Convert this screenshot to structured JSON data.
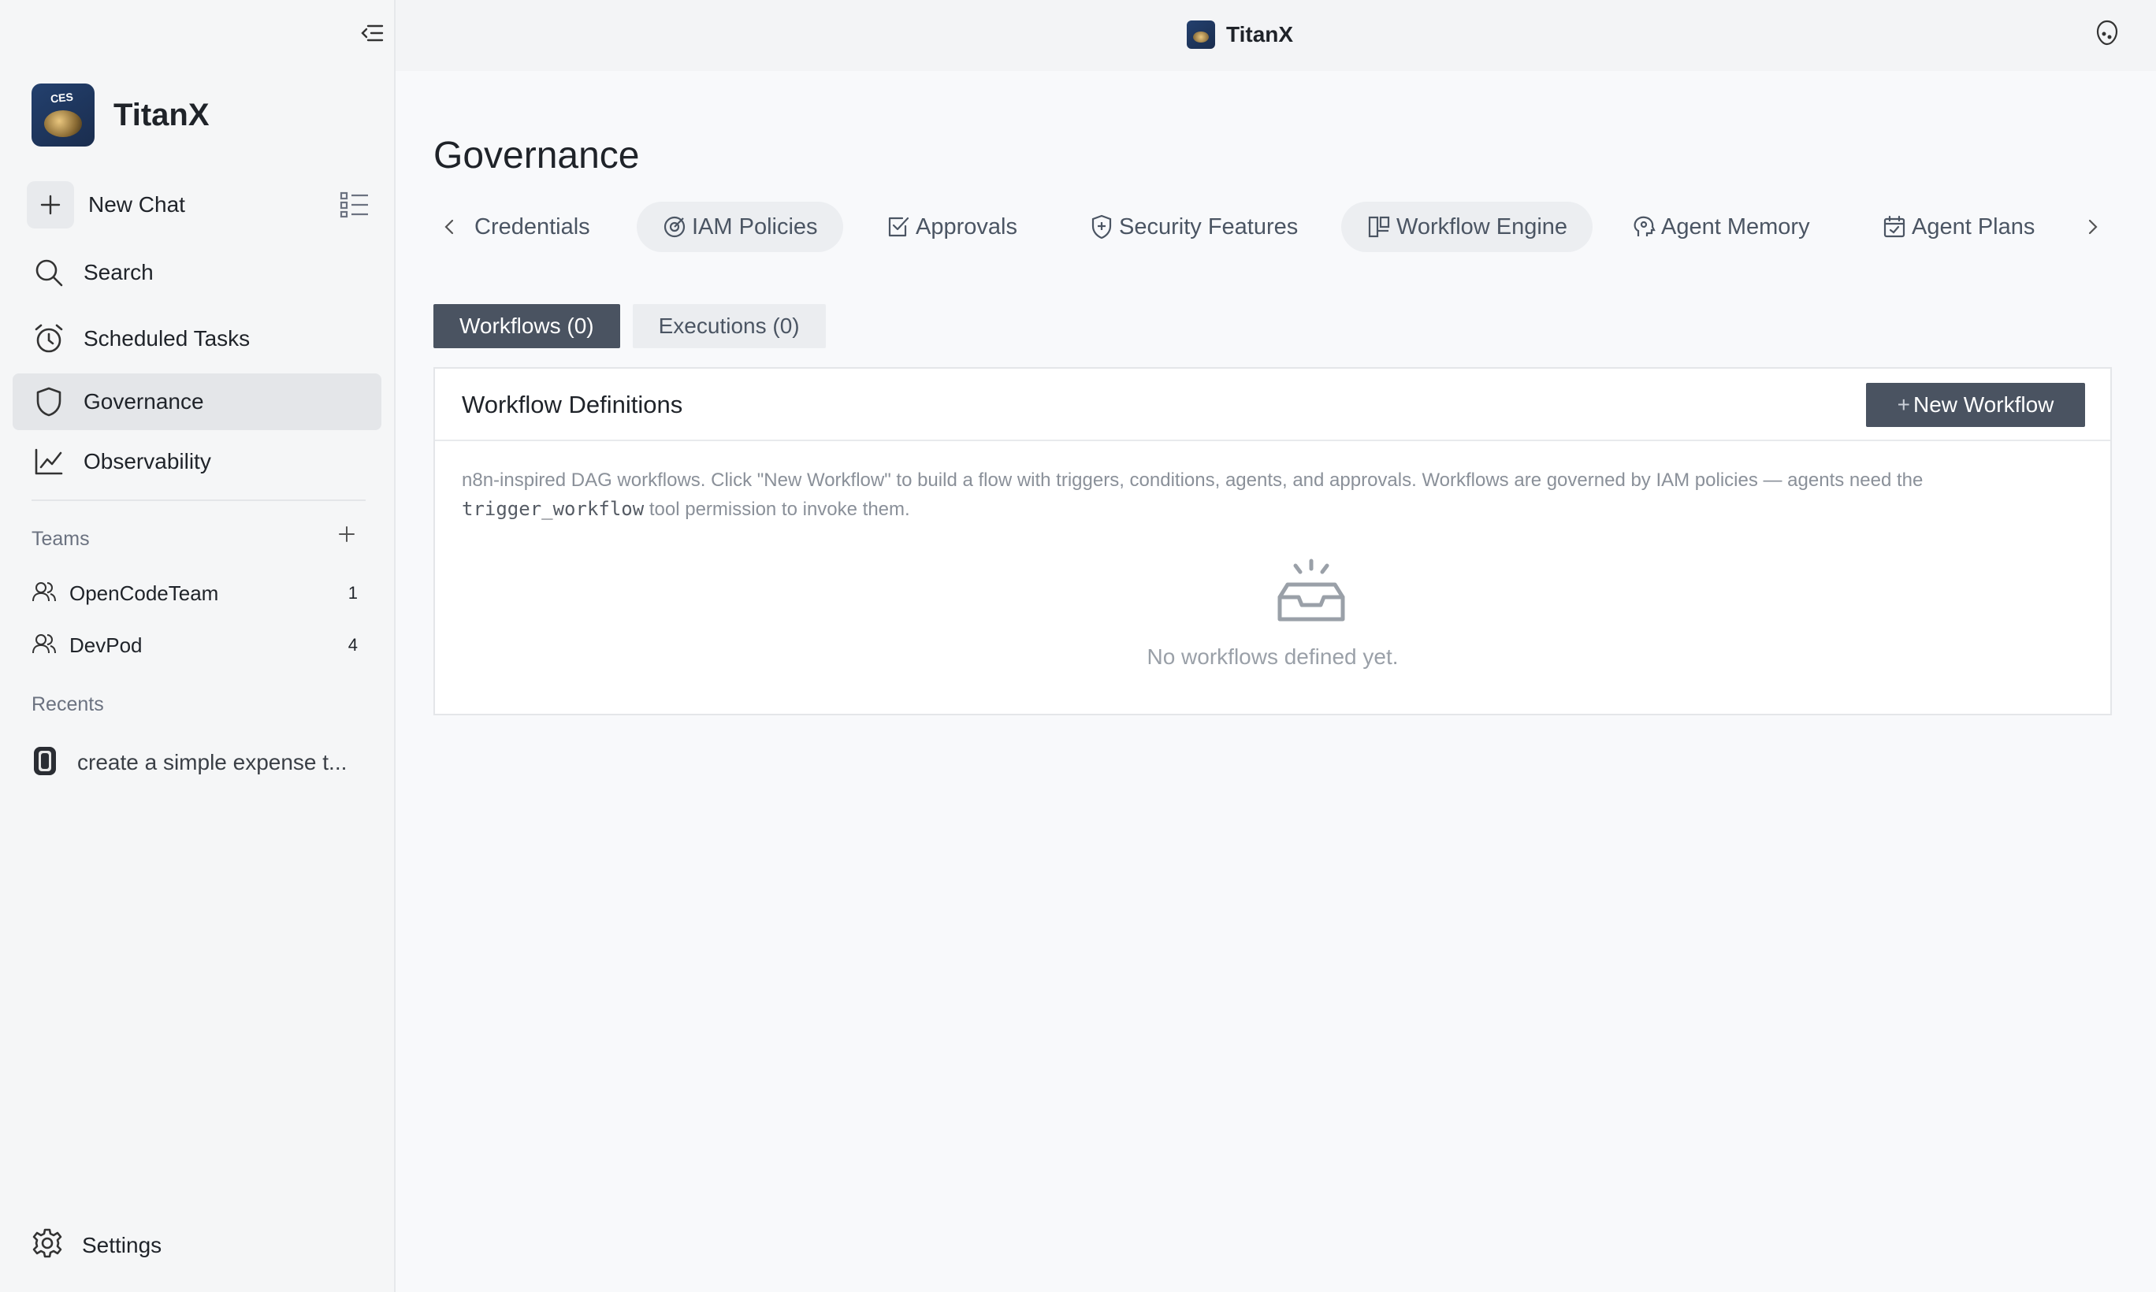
{
  "app": {
    "name": "TitanX"
  },
  "sidebar": {
    "new_chat": "New Chat",
    "nav": [
      {
        "label": "Search",
        "icon": "search-icon"
      },
      {
        "label": "Scheduled Tasks",
        "icon": "alarm-clock-icon"
      },
      {
        "label": "Governance",
        "icon": "shield-icon",
        "active": true
      },
      {
        "label": "Observability",
        "icon": "line-chart-icon"
      }
    ],
    "teams_title": "Teams",
    "teams": [
      {
        "label": "OpenCodeTeam",
        "count": "1"
      },
      {
        "label": "DevPod",
        "count": "4"
      }
    ],
    "recents_title": "Recents",
    "recents": [
      {
        "label": "create a simple expense t..."
      }
    ],
    "settings": "Settings"
  },
  "topbar": {
    "title": "TitanX"
  },
  "page": {
    "title": "Governance",
    "tabs": [
      {
        "label": "Credentials",
        "icon": "chevron-left-icon"
      },
      {
        "label": "IAM Policies",
        "icon": "target-icon"
      },
      {
        "label": "Approvals",
        "icon": "check-square-icon"
      },
      {
        "label": "Security Features",
        "icon": "shield-plus-icon"
      },
      {
        "label": "Workflow Engine",
        "icon": "workflow-icon",
        "active": true
      },
      {
        "label": "Agent Memory",
        "icon": "brain-icon"
      },
      {
        "label": "Agent Plans",
        "icon": "calendar-check-icon"
      }
    ],
    "subtabs": [
      {
        "label": "Workflows (0)",
        "active": true
      },
      {
        "label": "Executions (0)",
        "active": false
      }
    ],
    "card": {
      "title": "Workflow Definitions",
      "new_button": "New Workflow",
      "desc_before": "n8n-inspired DAG workflows. Click \"New Workflow\" to build a flow with triggers, conditions, agents, and approvals. Workflows are governed by IAM policies — agents need the",
      "desc_code": "trigger_workflow",
      "desc_after": "tool permission to invoke them.",
      "empty_text": "No workflows defined yet."
    }
  },
  "colors": {
    "accent_dark": "#4a5361",
    "sidebar_bg": "#f5f6f7",
    "active_nav": "#e4e6e9"
  }
}
